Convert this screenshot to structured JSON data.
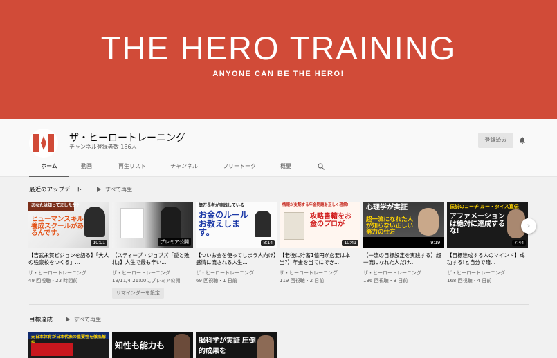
{
  "banner": {
    "title": "THE HERO TRAINING",
    "subtitle": "ANYONE CAN BE THE HERO!",
    "bg_color": "#d14b38"
  },
  "channel": {
    "name": "ザ・ヒーロートレーニング",
    "subscribers": "チャンネル登録者数 186人",
    "subscribed_label": "登録済み",
    "bell_icon": "bell-icon"
  },
  "tabs": [
    "ホーム",
    "動画",
    "再生リスト",
    "チャンネル",
    "フリートーク",
    "概要"
  ],
  "sections": [
    {
      "title": "最近のアップデート",
      "play_all": "すべて再生",
      "videos": [
        {
          "caption_top": "あなたは知ってましたか?",
          "caption_main": "ヒューマンスキル養成スクールがあるんです。",
          "duration": "10:01",
          "title": "【吉武永賀ビジョンを語る】「大人の強豪校をつくる」...",
          "channel": "ザ・ヒーロートレーニング",
          "meta": "49 回視聴・23 時間前"
        },
        {
          "caption_top": "",
          "caption_main": "",
          "duration": "プレミア公開",
          "title": "【スティーブ・ジョブズ「愛と敗北」】人生で最も辛い...",
          "channel": "ザ・ヒーロートレーニング",
          "meta": "19/11/4 21:00にプレミア公開",
          "reminder": "リマインダーを設定"
        },
        {
          "caption_top": "億万長者が実践している",
          "caption_main": "お金のルールお教えします。",
          "duration": "8:14",
          "title": "【ついお金を使ってしまう人向け】感情に流される人生...",
          "channel": "ザ・ヒーロートレーニング",
          "meta": "69 回視聴・1 日前"
        },
        {
          "caption_top": "情報が支配する年金問題を正しく理解!",
          "caption_main": "攻略書籍をお金のプロが",
          "duration": "10:41",
          "title": "【老後に貯蓄1億円が必要は本当?】年金を当てにでき...",
          "channel": "ザ・ヒーロートレーニング",
          "meta": "119 回視聴・2 日前"
        },
        {
          "caption_top": "心理学が実証",
          "caption_main": "超一流になれた人が知らない正しい努力の仕方",
          "duration": "9:19",
          "title": "【一流の目標設定を実践する】超一流になれた人だけ...",
          "channel": "ザ・ヒーロートレーニング",
          "meta": "136 回視聴・3 日前"
        },
        {
          "caption_top": "伝説のコーチ ルー・タイス直伝",
          "caption_main": "アファメーションは絶対に達成するな!",
          "duration": "7:44",
          "title": "【目標達成する人のマインド】成功する!と自分で暗...",
          "channel": "ザ・ヒーロートレーニング",
          "meta": "168 回視聴・4 日前"
        }
      ]
    },
    {
      "title": "目標達成",
      "play_all": "すべて再生",
      "videos": [
        {
          "caption_main": "元日本体育が日本代表の重要性を徹底解説"
        },
        {
          "caption_main": "知性も能力も"
        },
        {
          "caption_main": "脳科学が実証 圧倒的成果を"
        }
      ]
    }
  ]
}
